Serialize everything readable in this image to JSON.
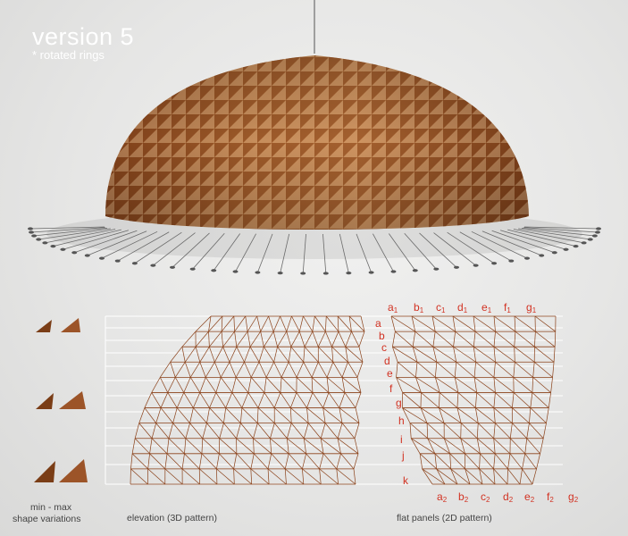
{
  "title": "version 5",
  "subtitle": "* rotated rings",
  "captions": {
    "min_max": "min - max",
    "shape_variations": "shape variations",
    "elevation": "elevation (3D pattern)",
    "flat_panels": "flat panels (2D pattern)"
  },
  "row_labels": [
    "a",
    "b",
    "c",
    "d",
    "e",
    "f",
    "g",
    "h",
    "i",
    "j",
    "k"
  ],
  "top_labels": [
    [
      "a",
      "1"
    ],
    [
      "b",
      "1"
    ],
    [
      "c",
      "1"
    ],
    [
      "d",
      "1"
    ],
    [
      "e",
      "1"
    ],
    [
      "f",
      "1"
    ],
    [
      "g",
      "1"
    ]
  ],
  "bottom_labels": [
    [
      "a",
      "2"
    ],
    [
      "b",
      "2"
    ],
    [
      "c",
      "2"
    ],
    [
      "d",
      "2"
    ],
    [
      "e",
      "2"
    ],
    [
      "f",
      "2"
    ],
    [
      "g",
      "2"
    ]
  ],
  "colors": {
    "wood_light": "#c98449",
    "wood_dark": "#7a3d16",
    "panel_line": "#8a4018",
    "label_red": "#d23222",
    "guide_line": "#ffffff"
  }
}
